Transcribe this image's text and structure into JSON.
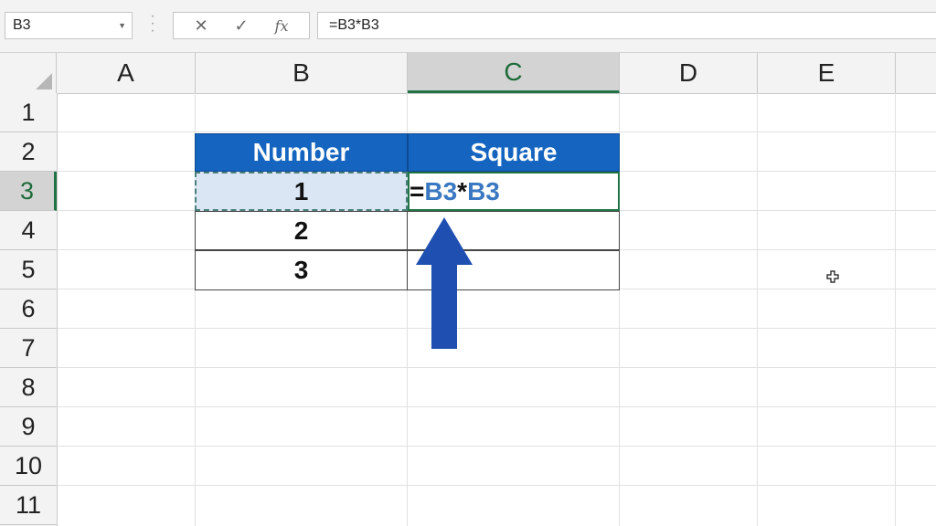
{
  "formula_bar": {
    "name_box": "B3",
    "cancel_icon": "close-icon",
    "enter_icon": "check-icon",
    "function_label": "fx",
    "formula": "=B3*B3"
  },
  "columns": [
    "A",
    "B",
    "C",
    "D",
    "E"
  ],
  "active_column": "C",
  "rows": [
    "1",
    "2",
    "3",
    "4",
    "5",
    "6",
    "7",
    "8",
    "9",
    "10",
    "11"
  ],
  "active_row": "3",
  "table": {
    "headers": [
      "Number",
      "Square"
    ],
    "numbers": [
      "1",
      "2",
      "3"
    ],
    "editing_cell": {
      "address": "C3",
      "parts": [
        "=",
        "B3",
        "*",
        "B3"
      ]
    }
  },
  "colors": {
    "header_fill": "#1565c0",
    "selection_green": "#217346",
    "reference_blue": "#3a78c2",
    "arrow_blue": "#1f4fb0"
  },
  "icons": {
    "arrow": "up-arrow-icon",
    "cursor": "cell-cursor-icon"
  }
}
